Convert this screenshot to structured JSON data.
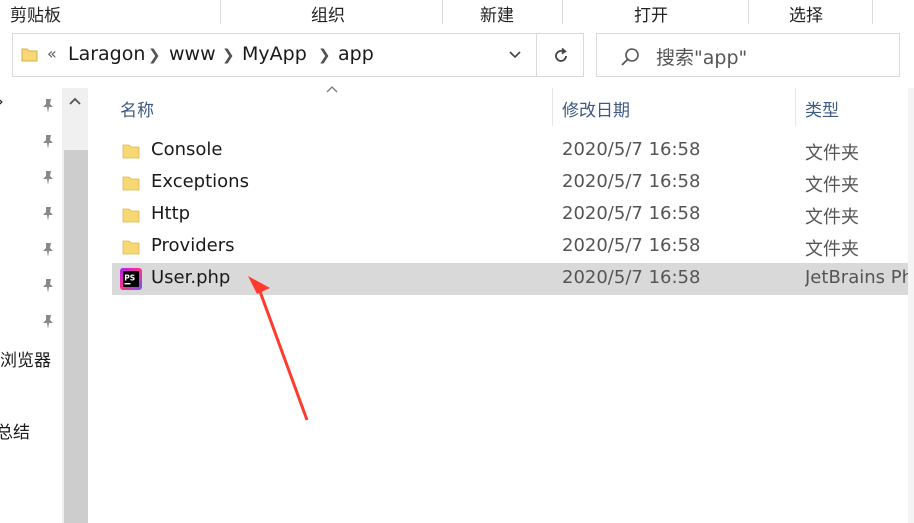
{
  "ribbon": {
    "clipboard": "剪贴板",
    "organize": "组织",
    "new": "新建",
    "open": "打开",
    "select": "选择"
  },
  "address": {
    "overflow": "«",
    "crumbs": [
      "Laragon",
      "www",
      "MyApp",
      "app"
    ]
  },
  "search": {
    "placeholder": "搜索\"app\""
  },
  "nav": {
    "items": [
      "浏览器",
      "总结"
    ]
  },
  "columns": {
    "name": "名称",
    "modified": "修改日期",
    "type": "类型"
  },
  "files": [
    {
      "name": "Console",
      "date": "2020/5/7 16:58",
      "type": "文件夹",
      "kind": "folder"
    },
    {
      "name": "Exceptions",
      "date": "2020/5/7 16:58",
      "type": "文件夹",
      "kind": "folder"
    },
    {
      "name": "Http",
      "date": "2020/5/7 16:58",
      "type": "文件夹",
      "kind": "folder"
    },
    {
      "name": "Providers",
      "date": "2020/5/7 16:58",
      "type": "文件夹",
      "kind": "folder"
    },
    {
      "name": "User.php",
      "date": "2020/5/7 16:58",
      "type": "JetBrains Php",
      "kind": "phpstorm-file",
      "selected": true
    }
  ],
  "phpstorm_icon_text": "PS",
  "colors": {
    "folder": "#f8d775",
    "selected_row": "#d9d9d9",
    "header_text": "#3c5a82",
    "annotation_arrow": "#ff3b30"
  }
}
